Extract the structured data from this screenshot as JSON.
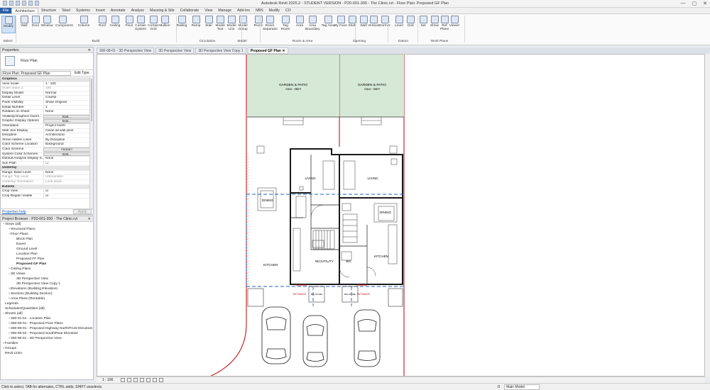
{
  "window": {
    "title": "Autodesk Revit 2025.2 - STUDENT VERSION - P20-001-300 - The Clinic.rvt - Floor Plan: Proposed GF Plan",
    "controls": [
      "—",
      "▢",
      "✕"
    ]
  },
  "menu_tabs": [
    "File",
    "Architecture",
    "Structure",
    "Steel",
    "Systems",
    "Insert",
    "Annotate",
    "Analyze",
    "Massing & Site",
    "Collaborate",
    "View",
    "Manage",
    "Add-Ins",
    "NBS",
    "Modify",
    "CO"
  ],
  "ribbon": {
    "buttons": [
      "Modify",
      "Wall",
      "Door",
      "Window",
      "Component",
      "Column",
      "Roof",
      "Ceiling",
      "Floor",
      "Curtain System",
      "Curtain Grid",
      "Mullion",
      "Railing",
      "Ramp",
      "Stair",
      "Model Text",
      "Model Line",
      "Model Group",
      "Room",
      "Room Separator",
      "Tag Room",
      "Area",
      "Area Boundary",
      "Tag Area",
      "By Face",
      "Shaft",
      "Wall",
      "Vertical",
      "Dormer",
      "Level",
      "Grid",
      "Set",
      "Show",
      "Ref Plane",
      "Viewer"
    ],
    "groups": [
      "Select",
      "Build",
      "Circulation",
      "Model",
      "Room & Area",
      "Opening",
      "Datum",
      "Work Plane"
    ]
  },
  "properties": {
    "header": "Properties",
    "type_name": "Floor Plan",
    "filter": "Floor Plan: Proposed GF Plan",
    "edit_type": "Edit Type",
    "rows": [
      {
        "k": "Graphics",
        "v": "",
        "cat": true
      },
      {
        "k": "View Scale",
        "v": "1 : 100"
      },
      {
        "k": "Scale Value  1:",
        "v": "100",
        "dim": true
      },
      {
        "k": "Display Model",
        "v": "Normal"
      },
      {
        "k": "Detail Level",
        "v": "Coarse"
      },
      {
        "k": "Parts Visibility",
        "v": "Show Original"
      },
      {
        "k": "Detail Number",
        "v": "1"
      },
      {
        "k": "Rotation on Sheet",
        "v": "None"
      },
      {
        "k": "Visibility/Graphics Overri...",
        "v": "Edit...",
        "btn": true
      },
      {
        "k": "Graphic Display Options",
        "v": "Edit...",
        "btn": true
      },
      {
        "k": "Orientation",
        "v": "Project North"
      },
      {
        "k": "Wall Join Display",
        "v": "Clean all wall joins"
      },
      {
        "k": "Discipline",
        "v": "Architectural"
      },
      {
        "k": "Show Hidden Lines",
        "v": "By Discipline"
      },
      {
        "k": "Color Scheme Location",
        "v": "Background"
      },
      {
        "k": "Color Scheme",
        "v": "<none>",
        "btn": true
      },
      {
        "k": "System Color Schemes",
        "v": "Edit...",
        "btn": true
      },
      {
        "k": "Default Analysis Display S...",
        "v": "None"
      },
      {
        "k": "Sun Path",
        "v": "☐"
      },
      {
        "k": "Underlay",
        "v": "",
        "cat": true
      },
      {
        "k": "Range: Base Level",
        "v": "None"
      },
      {
        "k": "Range: Top Level",
        "v": "Unbounded",
        "dim": true
      },
      {
        "k": "Underlay Orientation",
        "v": "Look down",
        "dim": true
      },
      {
        "k": "Extents",
        "v": "",
        "cat": true
      },
      {
        "k": "Crop View",
        "v": "☑"
      },
      {
        "k": "Crop Region Visible",
        "v": "☑"
      }
    ],
    "help": "Properties help",
    "apply": "Apply"
  },
  "browser": {
    "header": "Project Browser - P20-001-300 - The Clinic.rvt",
    "items": [
      {
        "t": "Views (all)",
        "d": 0,
        "e": "−"
      },
      {
        "t": "Structural Plans",
        "d": 1,
        "e": "+"
      },
      {
        "t": "Floor Plans",
        "d": 1,
        "e": "−"
      },
      {
        "t": "Block Plan",
        "d": 2,
        "e": ""
      },
      {
        "t": "Eaves",
        "d": 2,
        "e": ""
      },
      {
        "t": "Ground Level",
        "d": 2,
        "e": ""
      },
      {
        "t": "Location Plan",
        "d": 2,
        "e": ""
      },
      {
        "t": "Proposed FF Plan",
        "d": 2,
        "e": ""
      },
      {
        "t": "Proposed GF Plan",
        "d": 2,
        "e": "",
        "bold": true
      },
      {
        "t": "Ceiling Plans",
        "d": 1,
        "e": "+"
      },
      {
        "t": "3D Views",
        "d": 1,
        "e": "−"
      },
      {
        "t": "3D Perspective View",
        "d": 2,
        "e": ""
      },
      {
        "t": "3D Perspective View Copy 1",
        "d": 2,
        "e": ""
      },
      {
        "t": "Elevations (Building Elevation)",
        "d": 1,
        "e": "+"
      },
      {
        "t": "Sections (Building Section)",
        "d": 1,
        "e": "+"
      },
      {
        "t": "Area Plans (Rentable)",
        "d": 1,
        "e": "+"
      },
      {
        "t": "Legends",
        "d": 0,
        "e": ""
      },
      {
        "t": "Schedules/Quantities (all)",
        "d": 0,
        "e": ""
      },
      {
        "t": "Sheets (all)",
        "d": 0,
        "e": "−"
      },
      {
        "t": "300-01-01 - Location Plan",
        "d": 1,
        "e": "+"
      },
      {
        "t": "300-05-01 - Proposed Floor Plans",
        "d": 1,
        "e": "+"
      },
      {
        "t": "300-06-01 - Proposed Highway North/Front Elevation",
        "d": 1,
        "e": "+"
      },
      {
        "t": "300-06-02 - Proposed South/Rear Elevation",
        "d": 1,
        "e": "+"
      },
      {
        "t": "300-08-01 - 3D Perspective View",
        "d": 1,
        "e": "+"
      },
      {
        "t": "Families",
        "d": 0,
        "e": "+"
      },
      {
        "t": "Groups",
        "d": 0,
        "e": "+"
      },
      {
        "t": "Revit Links",
        "d": 0,
        "e": ""
      }
    ]
  },
  "view_tabs": [
    {
      "label": "300-08-01 - 3D Perspective View",
      "active": false
    },
    {
      "label": "3D Perspective View",
      "active": false
    },
    {
      "label": "3D Perspective View Copy 1",
      "active": false
    },
    {
      "label": "Proposed GF Plan",
      "active": true
    }
  ],
  "plan": {
    "garden_left": "GARDEN & PATIO",
    "garden_left_area": "Area - 45m²",
    "garden_right": "GARDEN & PATIO",
    "garden_right_area": "Area - 34m²",
    "living": "LIVING",
    "dining": "DINING",
    "kitchen": "KITCHEN",
    "wc_utility": "WC/UTILITY",
    "wc": "WC",
    "entrance": "ENTRANCE",
    "bin_store": "BIN STORE",
    "garden_color": "#d6e8d6"
  },
  "view_control": {
    "scale": "1 : 100"
  },
  "status": {
    "message": "Click to select, TAB for alternates, CTRL adds, SHIFT unselects.",
    "model": "Main Model",
    "zero": ":0"
  }
}
